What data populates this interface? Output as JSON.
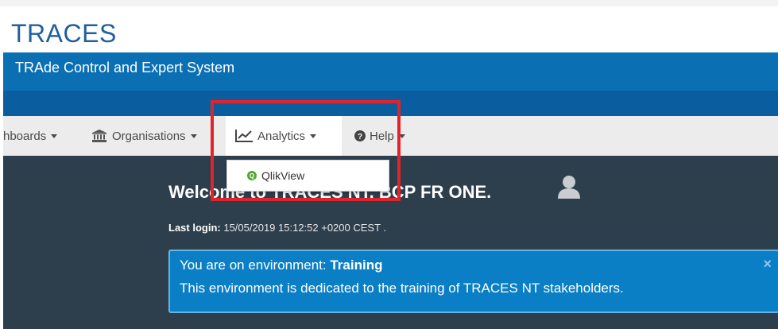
{
  "header": {
    "title": "TRACES",
    "subtitle": "TRAde Control and Expert System"
  },
  "navbar": {
    "dashboards_label": "hboards",
    "organisations_label": "Organisations",
    "analytics_label": "Analytics",
    "help_label": "Help"
  },
  "analytics_menu": {
    "items": [
      {
        "label": "QlikView",
        "icon": "qlikview-icon"
      }
    ]
  },
  "main": {
    "welcome_text": "Welcome to TRACES NT, BCP FR ONE.",
    "last_login_label": "Last login:",
    "last_login_value": "15/05/2019 15:12:52 +0200 CEST ."
  },
  "environment_alert": {
    "line1_prefix": "You are on environment:",
    "environment_name": "Training",
    "line2": "This environment is dedicated to the training of TRACES NT stakeholders.",
    "close_symbol": "×"
  },
  "colors": {
    "brand_blue": "#0b6fb4",
    "title_blue": "#1f5f9e",
    "dark_panel": "#2d3f4c",
    "alert_blue": "#0b7fc6",
    "highlight_red": "#e0242c",
    "qlik_green": "#52a832"
  }
}
